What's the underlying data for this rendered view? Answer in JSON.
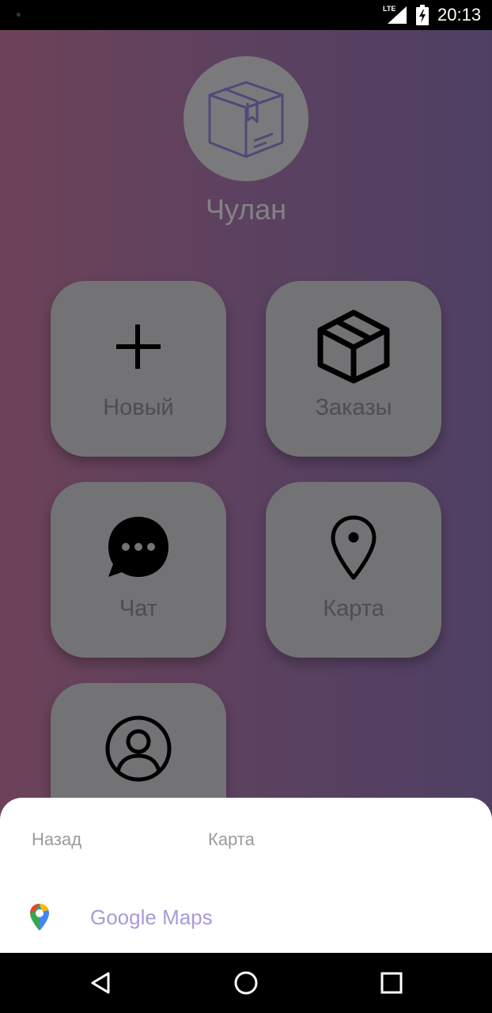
{
  "status_bar": {
    "network": "LTE",
    "time": "20:13"
  },
  "app": {
    "title": "Чулан",
    "logo_icon": "box-icon"
  },
  "tiles": [
    {
      "label": "Новый",
      "icon": "plus-icon"
    },
    {
      "label": "Заказы",
      "icon": "package-icon"
    },
    {
      "label": "Чат",
      "icon": "chat-bubble-icon"
    },
    {
      "label": "Карта",
      "icon": "map-pin-icon"
    },
    {
      "label": "",
      "icon": "user-circle-icon"
    }
  ],
  "bottom_sheet": {
    "back_label": "Назад",
    "title": "Карта",
    "options": [
      {
        "label": "Google Maps",
        "icon": "google-maps-icon"
      }
    ]
  },
  "colors": {
    "gradient_left": "#6d4258",
    "gradient_right": "#4f4063",
    "tile": "#737376",
    "option_text": "#a99bd6"
  }
}
